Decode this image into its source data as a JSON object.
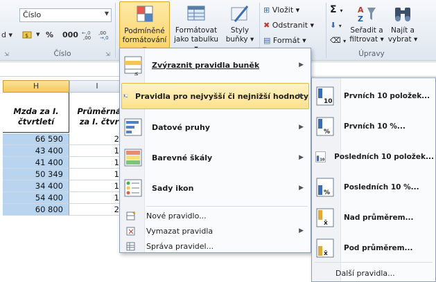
{
  "ribbon": {
    "number_format_value": "Číslo",
    "group_number_label": "Číslo",
    "group_edit_label": "Úpravy",
    "percent_symbol": "%",
    "thousands_symbol": "000",
    "cond_format": {
      "line1": "Podmíněné",
      "line2": "formátování ▾"
    },
    "format_table": {
      "line1": "Formátovat",
      "line2": "jako tabulku ▾"
    },
    "cell_styles": {
      "line1": "Styly",
      "line2": "buňky ▾"
    },
    "insert_label": "Vložit",
    "delete_label": "Odstranit",
    "format_label": "Formát",
    "sort_filter": {
      "line1": "Seřadit a",
      "line2": "filtrovat ▾"
    },
    "find_select": {
      "line1": "Najít a",
      "line2": "vybrat ▾"
    }
  },
  "grid": {
    "col_h": "H",
    "col_i": "I",
    "header_h": [
      "Mzda za I.",
      "čtvrtletí"
    ],
    "header_i": [
      "Průměrná",
      "za I. čtvr"
    ],
    "h_values": [
      "66 590",
      "43 400",
      "41 400",
      "50 349",
      "34 400",
      "54 400",
      "60 800"
    ],
    "i_values": [
      "2",
      "1",
      "1",
      "1",
      "1",
      "1",
      "2"
    ]
  },
  "main_menu": {
    "items": [
      {
        "label": "Zvýraznit pravidla buněk",
        "submenu": true
      },
      {
        "label": "Pravidla pro nejvyšší či nejnižší hodnoty",
        "submenu": true
      },
      {
        "label": "Datové pruhy",
        "submenu": true
      },
      {
        "label": "Barevné škály",
        "submenu": true
      },
      {
        "label": "Sady ikon",
        "submenu": true
      }
    ],
    "small_items": [
      {
        "label": "Nové pravidlo..."
      },
      {
        "label": "Vymazat pravidla",
        "submenu": true
      },
      {
        "label": "Správa pravidel..."
      }
    ]
  },
  "sub_menu": {
    "items": [
      {
        "label": "Prvních 10 položek...",
        "icon_text": "10"
      },
      {
        "label": "Prvních 10 %...",
        "icon_text": "%"
      },
      {
        "label": "Posledních 10 položek...",
        "icon_text": "10"
      },
      {
        "label": "Posledních 10 %...",
        "icon_text": "%"
      },
      {
        "label": "Nad průměrem...",
        "icon_text": "x̄"
      },
      {
        "label": "Pod průměrem...",
        "icon_text": "x̄"
      }
    ],
    "more_rules": "Další pravidla..."
  },
  "colors": {
    "highlight": "#fde18b",
    "cell_selected": "#b9d4ef",
    "accent_blue": "#1f5fa8"
  }
}
